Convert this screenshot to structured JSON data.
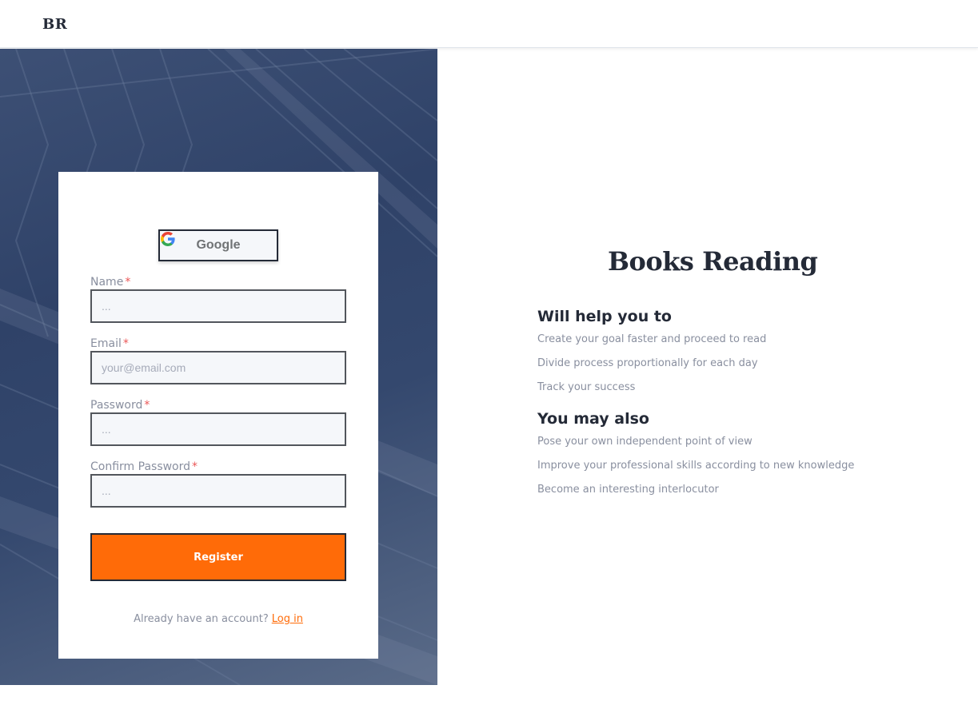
{
  "header": {
    "logo": "BR"
  },
  "form": {
    "google_label": "Google",
    "fields": [
      {
        "label": "Name",
        "required_mark": "*",
        "placeholder": "...",
        "value": ""
      },
      {
        "label": "Email",
        "required_mark": "*",
        "placeholder": "your@email.com",
        "value": ""
      },
      {
        "label": "Password",
        "required_mark": "*",
        "placeholder": "...",
        "value": ""
      },
      {
        "label": "Confirm Password",
        "required_mark": "*",
        "placeholder": "...",
        "value": ""
      }
    ],
    "register_label": "Register",
    "login_prompt": "Already have an account?",
    "login_link": "Log in"
  },
  "info": {
    "title": "Books Reading",
    "section1_title": "Will help you to",
    "section1_items": [
      "Create your goal faster and proceed to read",
      "Divide process proportionally for each day",
      "Track your success"
    ],
    "section2_title": "You may also",
    "section2_items": [
      "Pose your own independent point of view",
      "Improve your professional skills according to new knowledge",
      "Become an interesting interlocutor"
    ]
  },
  "colors": {
    "accent": "#ff6b08",
    "dark": "#242a37",
    "muted": "#898f9f",
    "panel": "#2f4268"
  },
  "icons": {
    "google": "google-g-icon"
  }
}
